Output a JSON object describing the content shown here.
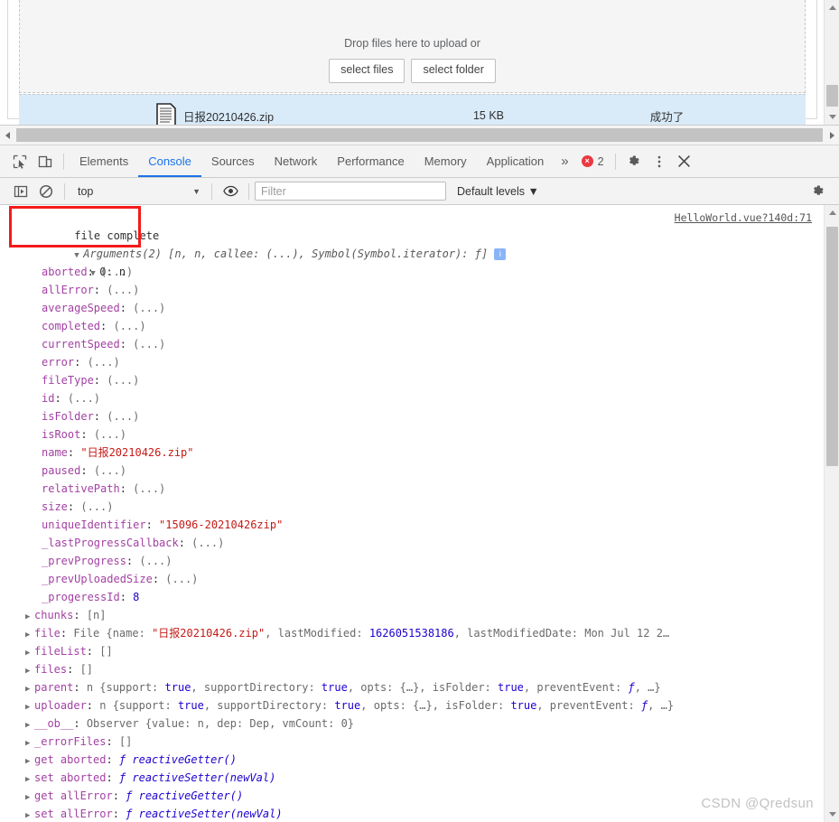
{
  "uploader": {
    "drop_text": "Drop files here to upload or",
    "select_files_label": "select files",
    "select_folder_label": "select folder",
    "file_row": {
      "name": "日报20210426.zip",
      "size": "15 KB",
      "status": "成功了"
    }
  },
  "devtools": {
    "tabs": [
      {
        "label": "Elements",
        "active": false
      },
      {
        "label": "Console",
        "active": true
      },
      {
        "label": "Sources",
        "active": false
      },
      {
        "label": "Network",
        "active": false
      },
      {
        "label": "Performance",
        "active": false
      },
      {
        "label": "Memory",
        "active": false
      },
      {
        "label": "Application",
        "active": false
      }
    ],
    "more_tabs_label": "»",
    "error_count": "2",
    "error_glyph": "×",
    "console_bar": {
      "context": "top",
      "context_caret": "▼",
      "filter_placeholder": "Filter",
      "filter_value": "",
      "levels_label": "Default levels ▼"
    },
    "accent_color": "#1a73e8",
    "error_color": "#eb3941"
  },
  "console": {
    "source_link": "HelloWorld.vue?140d:71",
    "header_text": "file complete",
    "args_label": "Arguments(2)",
    "args_tail": " [n, n, callee: (...), Symbol(Symbol.iterator): ƒ] ",
    "info_badge": "i",
    "index_line": "0: n",
    "props": [
      {
        "key": "aborted",
        "value": "(...)"
      },
      {
        "key": "allError",
        "value": "(...)"
      },
      {
        "key": "averageSpeed",
        "value": "(...)"
      },
      {
        "key": "completed",
        "value": "(...)"
      },
      {
        "key": "currentSpeed",
        "value": "(...)"
      },
      {
        "key": "error",
        "value": "(...)"
      },
      {
        "key": "fileType",
        "value": "(...)"
      },
      {
        "key": "id",
        "value": "(...)"
      },
      {
        "key": "isFolder",
        "value": "(...)"
      },
      {
        "key": "isRoot",
        "value": "(...)"
      },
      {
        "key": "name",
        "value": "\"日报20210426.zip\"",
        "kind": "string"
      },
      {
        "key": "paused",
        "value": "(...)"
      },
      {
        "key": "relativePath",
        "value": "(...)"
      },
      {
        "key": "size",
        "value": "(...)"
      },
      {
        "key": "uniqueIdentifier",
        "value": "\"15096-20210426zip\"",
        "kind": "string"
      },
      {
        "key": "_lastProgressCallback",
        "value": "(...)"
      },
      {
        "key": "_prevProgress",
        "value": "(...)"
      },
      {
        "key": "_prevUploadedSize",
        "value": "(...)"
      },
      {
        "key": "_progeressId",
        "value": "8",
        "kind": "number"
      }
    ],
    "expandable": [
      {
        "key": "chunks",
        "value": "[n]"
      },
      {
        "key": "file",
        "value": "File {name: \"日报20210426.zip\", lastModified: 1626051538186, lastModifiedDate: Mon Jul 12 2…"
      },
      {
        "key": "fileList",
        "value": "[]"
      },
      {
        "key": "files",
        "value": "[]"
      },
      {
        "key": "parent",
        "value": "n {support: true, supportDirectory: true, opts: {…}, isFolder: true, preventEvent: ƒ, …}"
      },
      {
        "key": "uploader",
        "value": "n {support: true, supportDirectory: true, opts: {…}, isFolder: true, preventEvent: ƒ, …}"
      },
      {
        "key": "__ob__",
        "value": "Observer {value: n, dep: Dep, vmCount: 0}"
      },
      {
        "key": "_errorFiles",
        "value": "[]"
      },
      {
        "key": "get aborted",
        "value": "ƒ reactiveGetter()"
      },
      {
        "key": "set aborted",
        "value": "ƒ reactiveSetter(newVal)"
      },
      {
        "key": "get allError",
        "value": "ƒ reactiveGetter()"
      },
      {
        "key": "set allError",
        "value": "ƒ reactiveSetter(newVal)"
      }
    ]
  },
  "annotation": {
    "highlight_color": "#f31a1a"
  },
  "watermark": {
    "text": "CSDN @Qredsun"
  }
}
